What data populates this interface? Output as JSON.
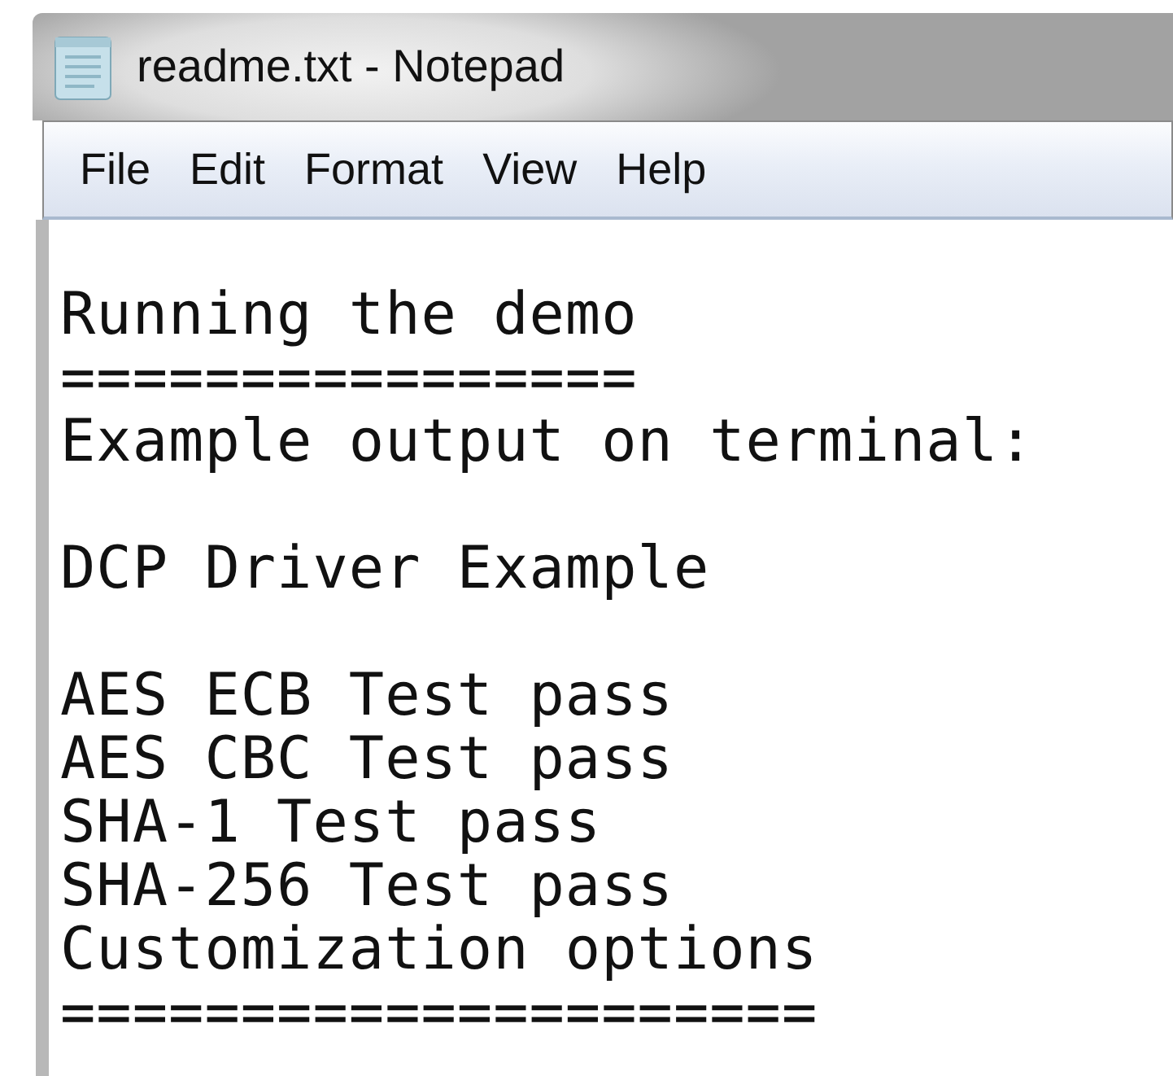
{
  "window": {
    "title": "readme.txt - Notepad"
  },
  "menu": [
    "File",
    "Edit",
    "Format",
    "View",
    "Help"
  ],
  "document": {
    "blocks": [
      [
        "Running the demo",
        "================",
        "Example output on terminal:"
      ],
      [
        "DCP Driver Example"
      ],
      [
        "AES ECB Test pass",
        "AES CBC Test pass",
        "SHA-1 Test pass",
        "SHA-256 Test pass",
        "Customization options",
        "====================="
      ]
    ]
  }
}
